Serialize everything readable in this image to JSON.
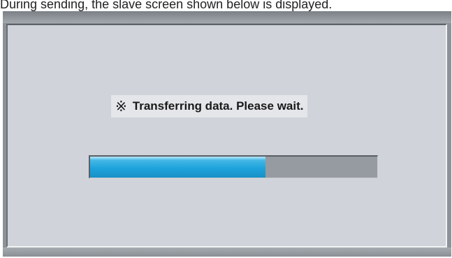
{
  "caption": "During sending, the slave screen shown below is displayed.",
  "dialog": {
    "message_mark": "※",
    "message": "Transferring data. Please wait."
  },
  "progress": {
    "fraction": 0.61,
    "fill_color": "#1ea3dc",
    "track_color": "#969ba1"
  }
}
